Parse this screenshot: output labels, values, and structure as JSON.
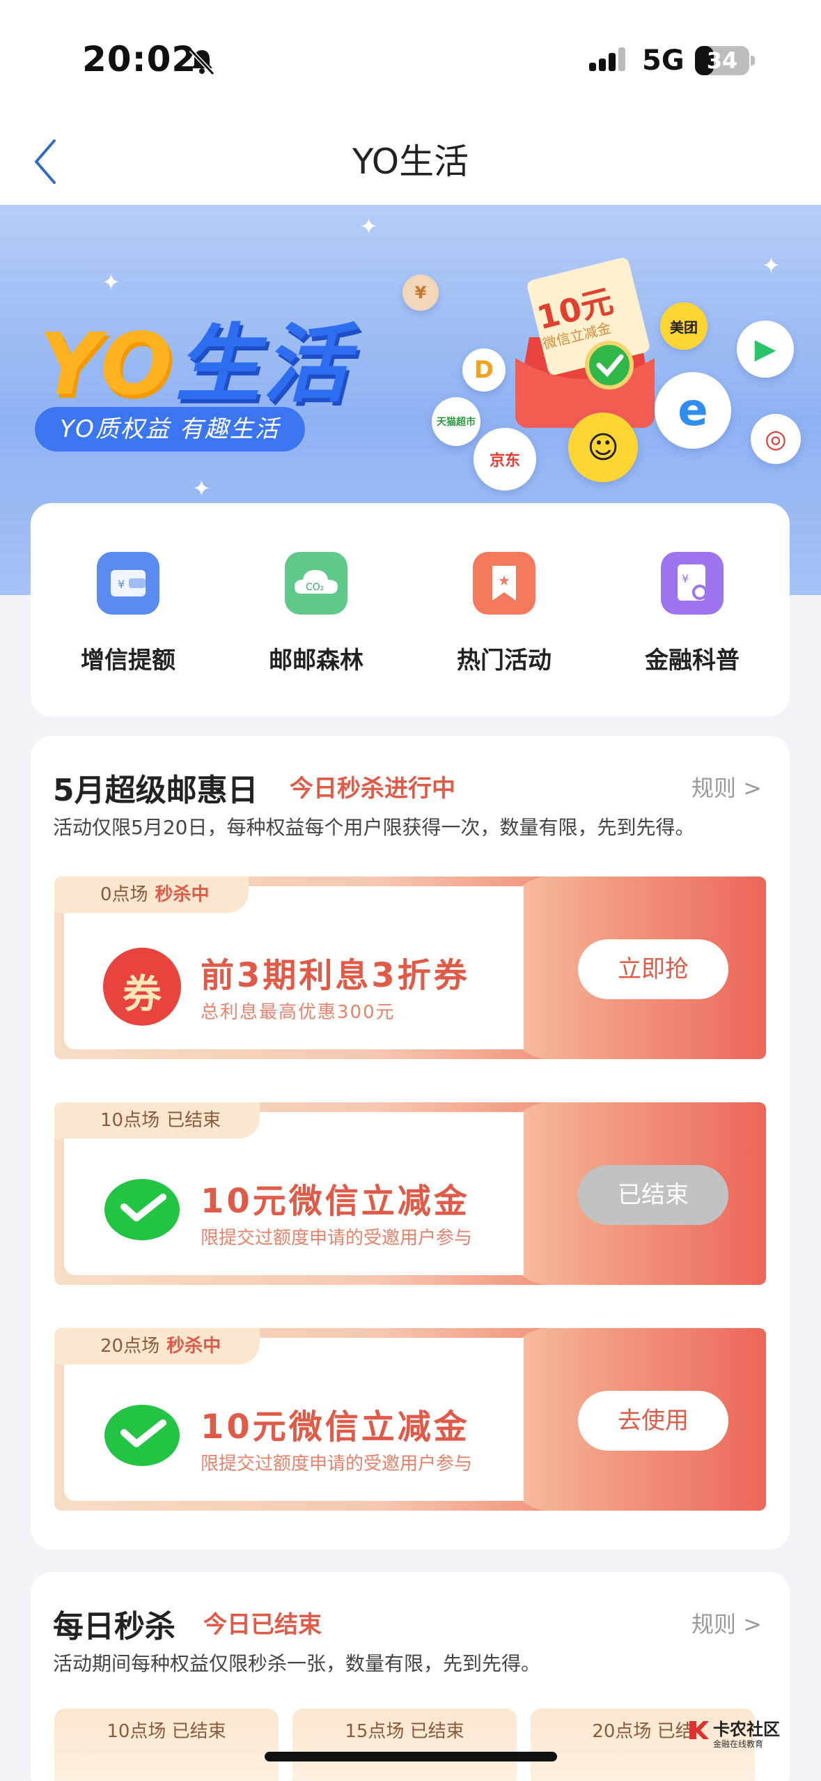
{
  "status_bar": {
    "time": "20:02",
    "network": "5G",
    "battery": "34",
    "battery_level": 0.34
  },
  "nav": {
    "title": "YO生活",
    "back_icon": "chevron-left-icon"
  },
  "banner": {
    "title_latin": "YO",
    "title_cn": "生活",
    "tagline": "YO质权益 有趣生活",
    "coupon_amount": "10元",
    "coupon_text": "微信立减金",
    "brand_jd": "京东",
    "brand_meituan": "美团",
    "brand_tmall": "天猫超市",
    "brand_didi": "D"
  },
  "quick_menu": [
    {
      "label": "增信提额",
      "icon": "wallet-icon",
      "color": "#5b8bf0"
    },
    {
      "label": "邮邮森林",
      "icon": "co2-cloud-icon",
      "color": "#5fc98a"
    },
    {
      "label": "热门活动",
      "icon": "star-bookmark-icon",
      "color": "#f3795c"
    },
    {
      "label": "金融科普",
      "icon": "finance-search-icon",
      "color": "#9e73ee"
    }
  ],
  "promo": {
    "title": "5月超级邮惠日",
    "status": "今日秒杀进行中",
    "rules": "规则 >",
    "desc": "活动仅限5月20日，每种权益每个用户限获得一次，数量有限，先到先得。",
    "offers": [
      {
        "session": "0点场",
        "state": "秒杀中",
        "title": "前3期利息3折券",
        "subtitle": "总利息最高优惠300元",
        "button": "立即抢",
        "icon": "coupon-quan-icon",
        "icon_text": "券",
        "ended": false
      },
      {
        "session": "10点场",
        "state": "已结束",
        "title": "10元微信立减金",
        "subtitle": "限提交过额度申请的受邀用户参与",
        "button": "已结束",
        "icon": "wechat-icon",
        "ended": true
      },
      {
        "session": "20点场",
        "state": "秒杀中",
        "title": "10元微信立减金",
        "subtitle": "限提交过额度申请的受邀用户参与",
        "button": "去使用",
        "icon": "wechat-icon",
        "ended": false
      }
    ]
  },
  "daily": {
    "title": "每日秒杀",
    "status": "今日已结束",
    "rules": "规则 >",
    "desc": "活动期间每种权益仅限秒杀一张，数量有限，先到先得。",
    "slots": [
      {
        "label": "10点场 已结束"
      },
      {
        "label": "15点场 已结束"
      },
      {
        "label": "20点场 已结"
      }
    ]
  },
  "watermark": {
    "title": "卡农社区",
    "subtitle": "金融在线教育"
  }
}
